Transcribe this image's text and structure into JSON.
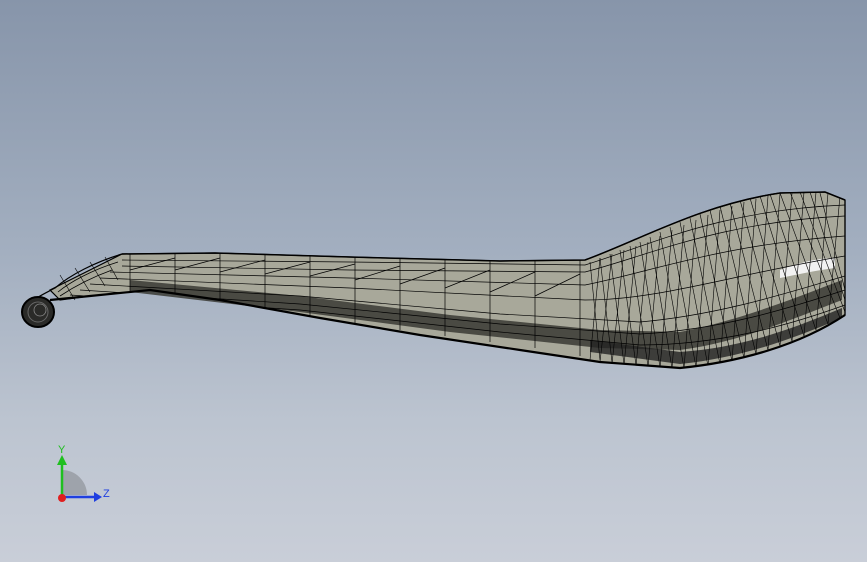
{
  "viewport": {
    "model": {
      "render_mode": "wireframe",
      "fill_color": "#a8a89a",
      "edge_color": "#000000"
    },
    "triad": {
      "y_label": "Y",
      "z_label": "Z",
      "y_color": "#1fbf1f",
      "z_color": "#1f3fe0",
      "x_color": "#e01f1f"
    }
  }
}
